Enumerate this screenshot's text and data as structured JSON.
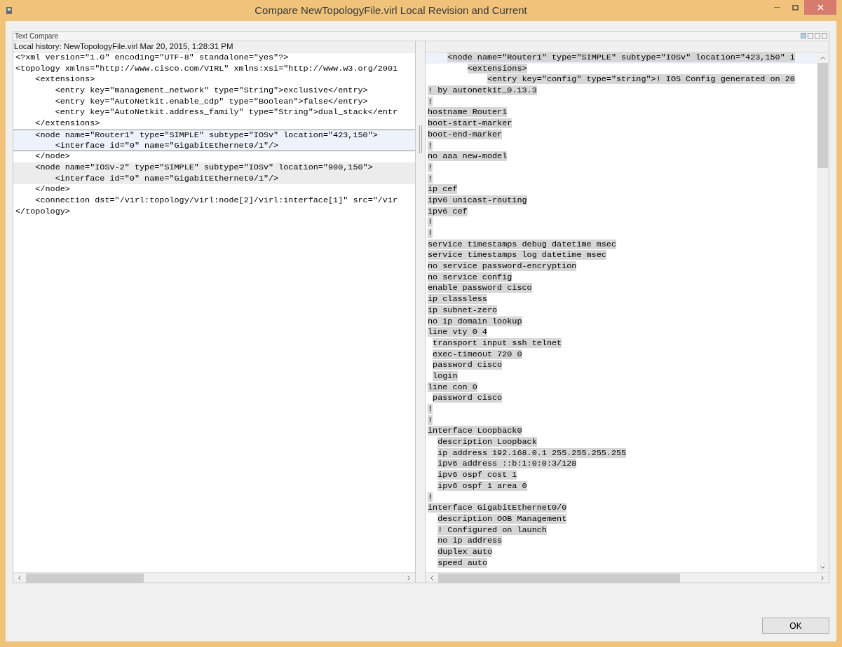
{
  "window": {
    "title": "Compare NewTopologyFile.virl Local Revision and Current"
  },
  "compare_view": {
    "title": "Text Compare"
  },
  "left_pane": {
    "header": "Local history: NewTopologyFile.virl Mar 20, 2015, 1:28:31 PM",
    "lines": [
      {
        "text": "<?xml version=\"1.0\" encoding=\"UTF-8\" standalone=\"yes\"?>",
        "kind": "plain"
      },
      {
        "text": "<topology xmlns=\"http://www.cisco.com/VIRL\" xmlns:xsi=\"http://www.w3.org/2001",
        "kind": "plain"
      },
      {
        "text": "    <extensions>",
        "kind": "plain"
      },
      {
        "text": "        <entry key=\"management_network\" type=\"String\">exclusive</entry>",
        "kind": "plain"
      },
      {
        "text": "        <entry key=\"AutoNetkit.enable_cdp\" type=\"Boolean\">false</entry>",
        "kind": "plain"
      },
      {
        "text": "        <entry key=\"AutoNetkit.address_family\" type=\"String\">dual_stack</entr",
        "kind": "plain"
      },
      {
        "text": "    </extensions>",
        "kind": "plain"
      },
      {
        "text": "    <node name=\"Router1\" type=\"SIMPLE\" subtype=\"IOSv\" location=\"423,150\">",
        "kind": "current"
      },
      {
        "text": "        <interface id=\"0\" name=\"GigabitEthernet0/1\"/>",
        "kind": "current"
      },
      {
        "text": "    </node>",
        "kind": "plain"
      },
      {
        "text": "    <node name=\"IOSv-2\" type=\"SIMPLE\" subtype=\"IOSv\" location=\"900,150\">",
        "kind": "changed"
      },
      {
        "text": "        <interface id=\"0\" name=\"GigabitEthernet0/1\"/>",
        "kind": "changed"
      },
      {
        "text": "    </node>",
        "kind": "plain"
      },
      {
        "text": "    <connection dst=\"/virl:topology/virl:node[2]/virl:interface[1]\" src=\"/vir",
        "kind": "plain"
      },
      {
        "text": "</topology>",
        "kind": "plain"
      }
    ]
  },
  "right_pane": {
    "lines": [
      {
        "text": "    <node name=\"Router1\" type=\"SIMPLE\" subtype=\"IOSv\" location=\"423,150\" i",
        "kind": "current"
      },
      {
        "text": "        <extensions>",
        "kind": "changed"
      },
      {
        "text": "            <entry key=\"config\" type=\"string\">! IOS Config generated on 20",
        "kind": "changed"
      },
      {
        "text": "! by autonetkit_0.13.3",
        "kind": "changed"
      },
      {
        "text": "!",
        "kind": "changed"
      },
      {
        "text": "hostname Router1",
        "kind": "changed"
      },
      {
        "text": "boot-start-marker",
        "kind": "changed"
      },
      {
        "text": "boot-end-marker",
        "kind": "changed"
      },
      {
        "text": "!",
        "kind": "changed"
      },
      {
        "text": "no aaa new-model",
        "kind": "changed"
      },
      {
        "text": "!",
        "kind": "changed"
      },
      {
        "text": "!",
        "kind": "changed"
      },
      {
        "text": "ip cef",
        "kind": "changed"
      },
      {
        "text": "ipv6 unicast-routing",
        "kind": "changed"
      },
      {
        "text": "ipv6 cef",
        "kind": "changed"
      },
      {
        "text": "!",
        "kind": "changed"
      },
      {
        "text": "!",
        "kind": "changed"
      },
      {
        "text": "service timestamps debug datetime msec",
        "kind": "changed"
      },
      {
        "text": "service timestamps log datetime msec",
        "kind": "changed"
      },
      {
        "text": "no service password-encryption",
        "kind": "changed"
      },
      {
        "text": "no service config",
        "kind": "changed"
      },
      {
        "text": "enable password cisco",
        "kind": "changed"
      },
      {
        "text": "ip classless",
        "kind": "changed"
      },
      {
        "text": "ip subnet-zero",
        "kind": "changed"
      },
      {
        "text": "no ip domain lookup",
        "kind": "changed"
      },
      {
        "text": "line vty 0 4",
        "kind": "changed"
      },
      {
        "text": " transport input ssh telnet",
        "kind": "changed"
      },
      {
        "text": " exec-timeout 720 0",
        "kind": "changed"
      },
      {
        "text": " password cisco",
        "kind": "changed"
      },
      {
        "text": " login",
        "kind": "changed"
      },
      {
        "text": "line con 0",
        "kind": "changed"
      },
      {
        "text": " password cisco",
        "kind": "changed"
      },
      {
        "text": "!",
        "kind": "changed"
      },
      {
        "text": "!",
        "kind": "changed"
      },
      {
        "text": "interface Loopback0",
        "kind": "changed"
      },
      {
        "text": "  description Loopback",
        "kind": "changed"
      },
      {
        "text": "  ip address 192.168.0.1 255.255.255.255",
        "kind": "changed"
      },
      {
        "text": "  ipv6 address ::b:1:0:0:3/128",
        "kind": "changed"
      },
      {
        "text": "  ipv6 ospf cost 1",
        "kind": "changed"
      },
      {
        "text": "  ipv6 ospf 1 area 0",
        "kind": "changed"
      },
      {
        "text": "!",
        "kind": "changed"
      },
      {
        "text": "interface GigabitEthernet0/0",
        "kind": "changed"
      },
      {
        "text": "  description OOB Management",
        "kind": "changed"
      },
      {
        "text": "  ! Configured on launch",
        "kind": "changed"
      },
      {
        "text": "  no ip address",
        "kind": "changed"
      },
      {
        "text": "  duplex auto",
        "kind": "changed"
      },
      {
        "text": "  speed auto",
        "kind": "changed"
      }
    ]
  },
  "buttons": [
    {
      "label": "OK"
    }
  ]
}
